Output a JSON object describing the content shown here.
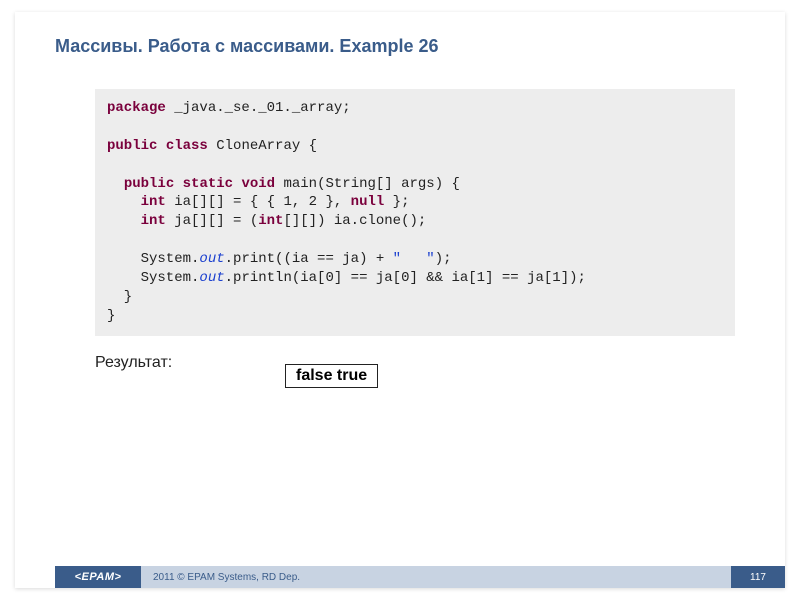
{
  "title": "Массивы. Работа с массивами. Example 26",
  "code": {
    "l1_package": "package",
    "l1_rest": " _java._se._01._array;",
    "l3_public": "public",
    "l3_class": "class",
    "l3_name": " CloneArray {",
    "l5_public": "public",
    "l5_static": "static",
    "l5_void": "void",
    "l5_rest": " main(String[] args) {",
    "l6_int": "int",
    "l6_mid": " ia[][] = { { 1, 2 }, ",
    "l6_null": "null",
    "l6_end": " };",
    "l7_int": "int",
    "l7_mid": " ja[][] = (",
    "l7_int2": "int",
    "l7_end": "[][]) ia.clone();",
    "l9_a": "    System.",
    "l9_out": "out",
    "l9_b": ".print((ia == ja) + ",
    "l9_str": "\"   \"",
    "l9_c": ");",
    "l10_a": "    System.",
    "l10_out": "out",
    "l10_b": ".println(ia[0] == ja[0] && ia[1] == ja[1]);",
    "l11": "  }",
    "l12": "}"
  },
  "result_label": "Результат:",
  "result_value": "false   true",
  "footer": {
    "logo": "<EPAM>",
    "copyright": "2011 © EPAM Systems, RD Dep.",
    "page": "117"
  }
}
